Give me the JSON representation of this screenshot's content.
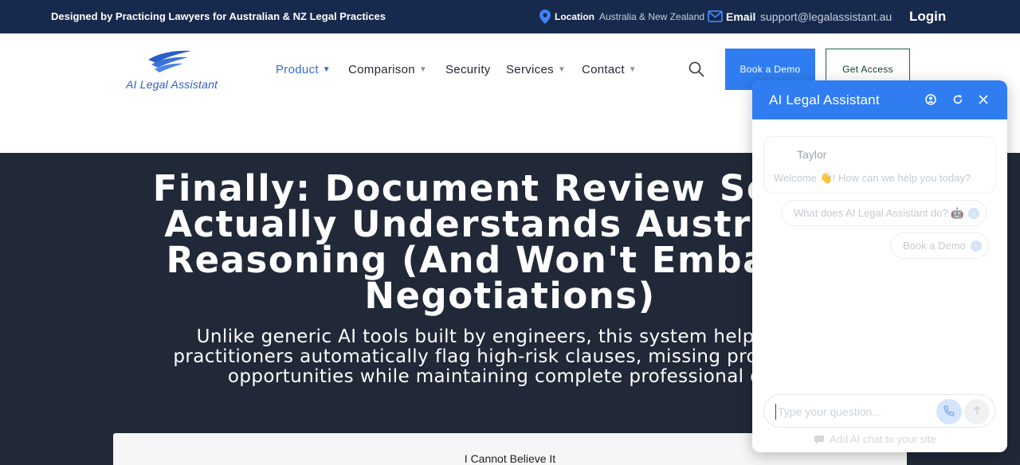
{
  "topbar": {
    "tagline": "Designed by Practicing Lawyers for Australian & NZ Legal Practices",
    "location_label": "Location",
    "location_value": "Australia & New Zealand",
    "email_label": "Email",
    "email_value": "support@legalassistant.au",
    "login_label": "Login"
  },
  "nav": {
    "logo_text": "AI Legal Assistant",
    "items": [
      {
        "label": "Product",
        "dropdown": true,
        "active": true
      },
      {
        "label": "Comparison",
        "dropdown": true
      },
      {
        "label": "Security",
        "dropdown": false
      },
      {
        "label": "Services",
        "dropdown": true
      },
      {
        "label": "Contact",
        "dropdown": true
      }
    ],
    "demo_label": "Book a Demo",
    "access_label": "Get Access"
  },
  "hero": {
    "title_lines": [
      "Finally: Document Review Softwa",
      "Actually Understands Australian",
      "Reasoning (And Won't Embarras",
      "Negotiations)"
    ],
    "subtitle_lines": [
      "Unlike generic AI tools built by engineers, this system helps forwa",
      "practitioners automatically flag high-risk clauses, missing provisions, a",
      "opportunities while maintaining complete professional over"
    ],
    "card_title": "I Cannot Believe It"
  },
  "chat": {
    "title": "AI Legal Assistant",
    "agent_name": "Taylor",
    "welcome_message": "Welcome 👋! How can we help you today?",
    "suggestions": [
      "What does AI Legal Assistant do? 🤖",
      "Book a Demo"
    ],
    "input_placeholder": "Type your question...",
    "footer_text": "Add AI chat to your site"
  },
  "colors": {
    "topbar_bg": "#17294c",
    "accent": "#2f7df0",
    "hero_bg": "#212837"
  },
  "icons": [
    "location-pin-icon",
    "mail-icon",
    "logo-wings-icon",
    "chevron-down-icon",
    "search-icon",
    "user-circle-icon",
    "refresh-icon",
    "close-icon",
    "arrow-right-icon",
    "phone-icon",
    "send-arrow-icon",
    "chat-icon"
  ]
}
